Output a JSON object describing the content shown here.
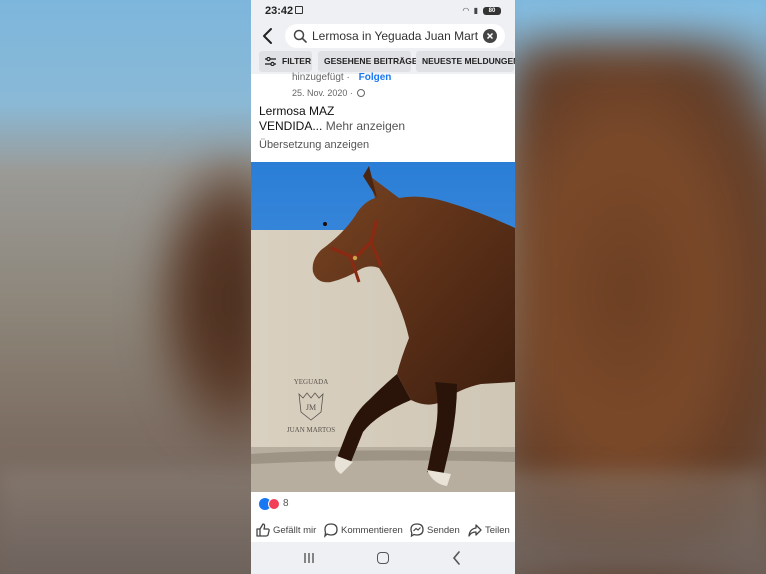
{
  "status_bar": {
    "time": "23:42",
    "battery": "80",
    "icons": "◠ ▮"
  },
  "search": {
    "query": "Lermosa in Yeguada Juan Martos"
  },
  "chips": [
    {
      "label": "FILTER"
    },
    {
      "label": "GESEHENE BEITRÄGE"
    },
    {
      "label": "NEUESTE MELDUNGEN"
    }
  ],
  "post": {
    "meta_partial": "hinzugefügt ·",
    "follow_label": "Folgen",
    "date": "25. Nov. 2020 ·",
    "title": "Lermosa MAZ",
    "body_start": "VENDIDA...",
    "more_label": "Mehr anzeigen",
    "translate_label": "Übersetzung anzeigen",
    "watermark": {
      "line1": "YEGUADA",
      "monogram": "JM",
      "line2": "JUAN MARTOS"
    }
  },
  "reactions": {
    "count": "8"
  },
  "actions": {
    "like": "Gefällt mir",
    "comment": "Kommentieren",
    "send": "Senden",
    "share": "Teilen"
  },
  "colors": {
    "link_blue": "#1877f2",
    "love_red": "#f33e58",
    "sky": "#2c7fd6"
  }
}
